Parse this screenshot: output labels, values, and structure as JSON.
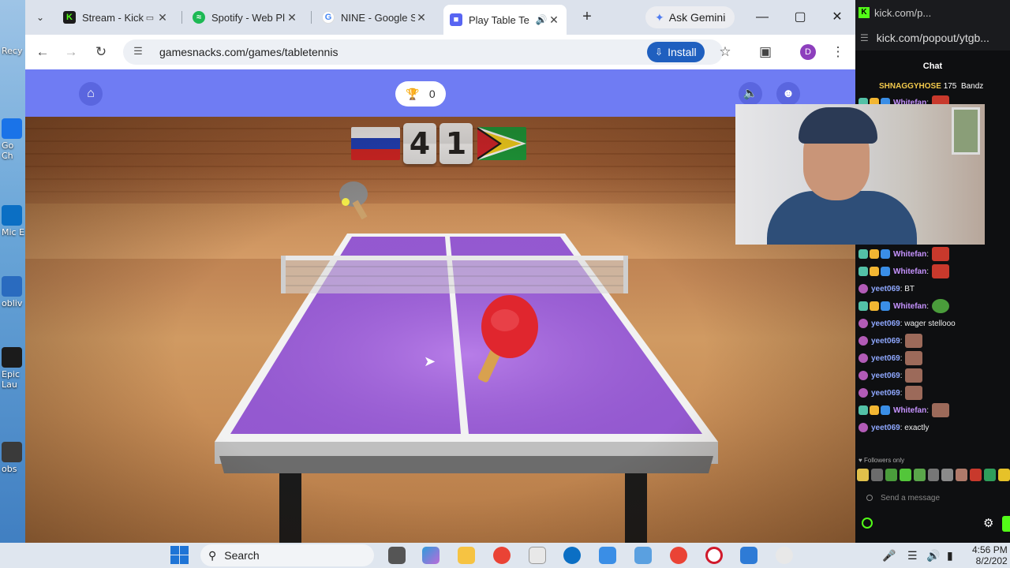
{
  "desktop": {
    "icons": [
      "Recy",
      "Go Ch",
      "Mic E",
      "obliv",
      "Epic Lau",
      "obs"
    ]
  },
  "browser": {
    "tabs": [
      {
        "label": "Stream - Kick",
        "icon": "kick-icon",
        "color": "#53fc18"
      },
      {
        "label": "Spotify - Web Pl",
        "icon": "spotify-icon",
        "color": "#1db954"
      },
      {
        "label": "NINE - Google S",
        "icon": "google-icon",
        "color": "#4285f4"
      },
      {
        "label": "Play Table Te",
        "icon": "gamesnacks-icon",
        "color": "#5865f2"
      }
    ],
    "ask_gemini": "Ask Gemini",
    "url": "gamesnacks.com/games/tabletennis",
    "install_label": "Install",
    "profile_initial": "D"
  },
  "game": {
    "trophy_score": "0",
    "score_left": "4",
    "score_right": "1",
    "left_flag": "russia-flag",
    "right_flag": "guyana-flag",
    "colors": {
      "bar": "#6f7cf3",
      "table": "#9a5fd6",
      "paddle": "#e0262e"
    }
  },
  "chat_popout": {
    "title_url": "kick.com/p...",
    "url": "kick.com/popout/ytgb...",
    "header": "Chat",
    "pinned_user": "SHNAGGYHOSE",
    "pinned_count": "175",
    "pinned_second": "Bandz",
    "messages": [
      {
        "user": "Whitefan",
        "text": ":",
        "emote": "red"
      },
      {
        "user": "Whitefan",
        "text": ":",
        "emote": "red"
      },
      {
        "user": "Whitefan",
        "text": ":",
        "emote": "red"
      },
      {
        "user": "yeet069",
        "text": ": BT",
        "emote": ""
      },
      {
        "user": "Whitefan",
        "text": ":",
        "emote": "frog"
      },
      {
        "user": "yeet069",
        "text": ": wager stellooo",
        "emote": ""
      },
      {
        "user": "yeet069",
        "text": ":",
        "emote": "face"
      },
      {
        "user": "yeet069",
        "text": ":",
        "emote": "face"
      },
      {
        "user": "yeet069",
        "text": ":",
        "emote": "face"
      },
      {
        "user": "yeet069",
        "text": ":",
        "emote": "face"
      },
      {
        "user": "Whitefan",
        "text": ":",
        "emote": "face"
      },
      {
        "user": "yeet069",
        "text": ": exactly",
        "emote": ""
      }
    ],
    "followers_only": "Followers only",
    "send_placeholder": "Send a message"
  },
  "taskbar": {
    "search_label": "Search",
    "time": "4:56 PM",
    "date": "8/2/202"
  }
}
